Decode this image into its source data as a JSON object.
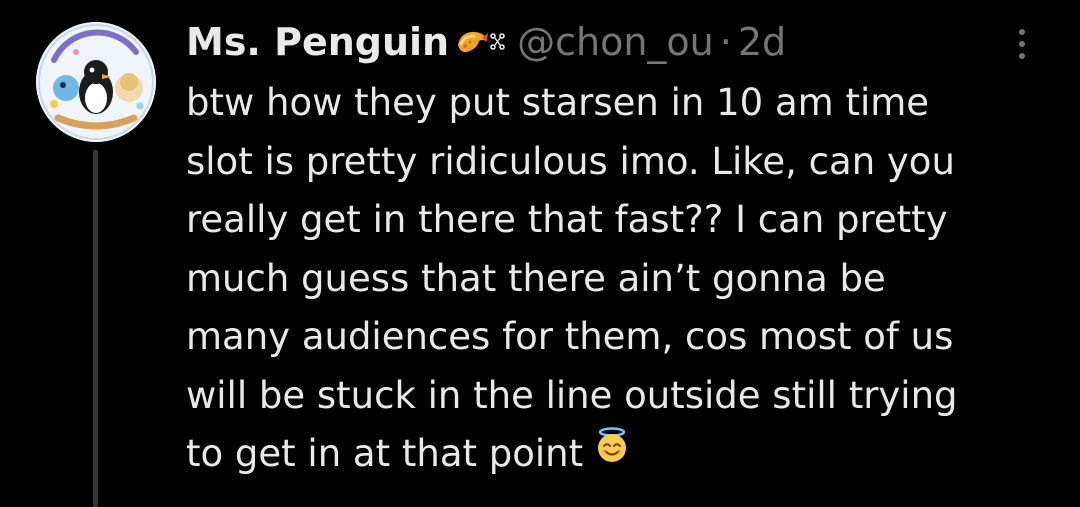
{
  "author": {
    "display_name": "Ms. Penguin",
    "handle": "@chon_ou",
    "separator": "·",
    "timestamp": "2d",
    "name_emojis": [
      "shrimp-tempura-emoji",
      "sparkles-glyph"
    ]
  },
  "tweet": {
    "lines": [
      "btw how they put starsen in 10 am time",
      "slot is pretty ridiculous imo. Like, can you",
      "really get in there that fast?? I can pretty",
      "much guess that there ain’t gonna be",
      "many audiences for them, cos most of us",
      "will be stuck in the line outside still trying",
      "to get in at that point"
    ],
    "trailing_emoji": "smiling-face-with-halo"
  },
  "colors": {
    "background": "#000000",
    "primary_text": "#e7e9ea",
    "secondary_text": "#71767b",
    "thread_line": "#333639"
  },
  "icons": {
    "more": "more-vertical-icon"
  }
}
